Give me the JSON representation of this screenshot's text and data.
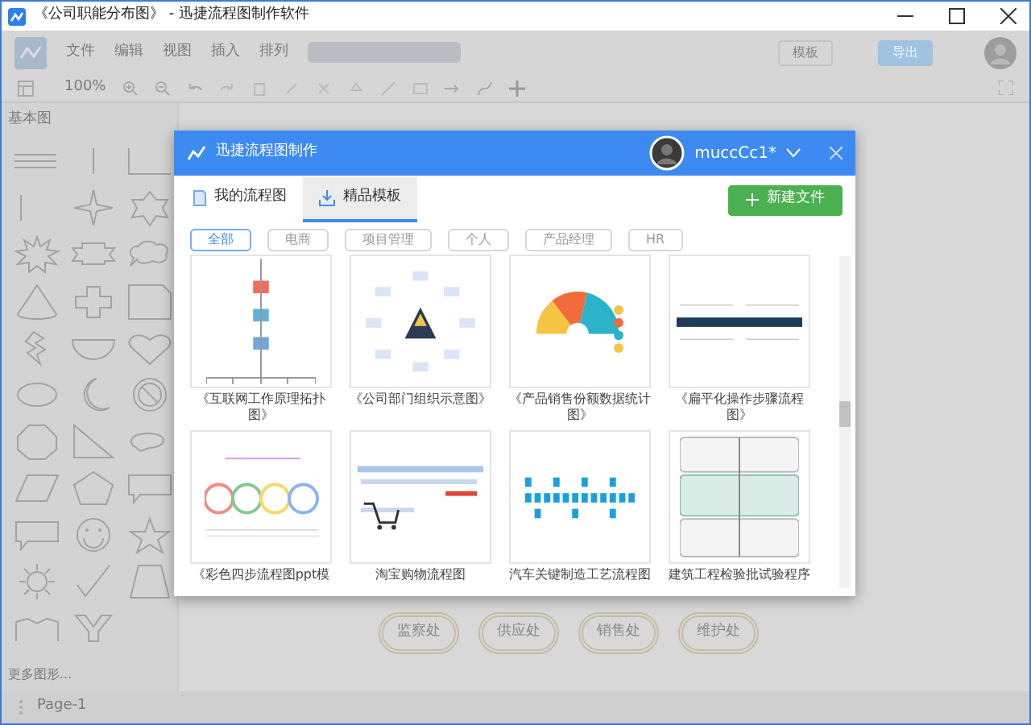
{
  "window": {
    "title": "《公司职能分布图》 - 迅捷流程图制作软件"
  },
  "menu": [
    "文件",
    "编辑",
    "视图",
    "插入",
    "排列"
  ],
  "header_buttons": [
    {
      "label": "模板",
      "kind": "outline"
    },
    {
      "label": "导出",
      "kind": "primary"
    }
  ],
  "toolbar": {
    "zoom": "100%"
  },
  "sidebar": {
    "section": "基本图",
    "more": "更多图形..."
  },
  "canvas": {
    "nodes": [
      "监察处",
      "供应处",
      "销售处",
      "维护处"
    ]
  },
  "page_tab": "Page-1",
  "dialog": {
    "title": "迅捷流程图制作",
    "user": "muccCc1*",
    "tabs": [
      {
        "label": "我的流程图",
        "selected": false
      },
      {
        "label": "精品模板",
        "selected": true
      }
    ],
    "new_button": "新建文件",
    "filters": [
      {
        "label": "全部",
        "selected": true
      },
      {
        "label": "电商",
        "selected": false
      },
      {
        "label": "项目管理",
        "selected": false
      },
      {
        "label": "个人",
        "selected": false
      },
      {
        "label": "产品经理",
        "selected": false
      },
      {
        "label": "HR",
        "selected": false
      }
    ],
    "templates": [
      {
        "label": "《互联网工作原理拓扑图》",
        "kind": "tree"
      },
      {
        "label": "《公司部门组织示意图》",
        "kind": "radial"
      },
      {
        "label": "《产品销售份额数据统计图》",
        "kind": "pie"
      },
      {
        "label": "《扁平化操作步骤流程图》",
        "kind": "steps"
      },
      {
        "label": "《彩色四步流程图ppt模",
        "kind": "circles"
      },
      {
        "label": "淘宝购物流程图",
        "kind": "cart"
      },
      {
        "label": "汽车关键制造工艺流程图",
        "kind": "blocks"
      },
      {
        "label": "建筑工程检验批试验程序",
        "kind": "flow"
      }
    ]
  }
}
